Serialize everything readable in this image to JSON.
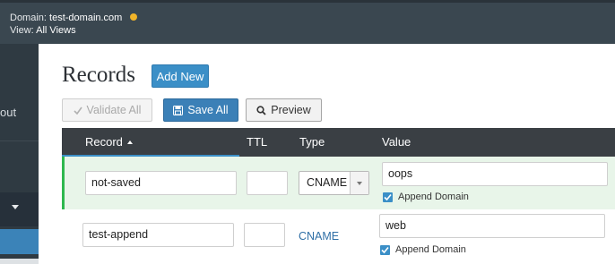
{
  "topbar": {
    "domain_key": "Domain:",
    "domain_value": "test-domain.com",
    "view_key": "View:",
    "view_value": "All Views"
  },
  "sidebar": {
    "logout_partial": "out"
  },
  "page": {
    "title": "Records",
    "add_new_label": "Add New"
  },
  "toolbar": {
    "validate_label": "Validate All",
    "save_label": "Save All",
    "preview_label": "Preview"
  },
  "table": {
    "headers": [
      "Record",
      "TTL",
      "Type",
      "Value"
    ],
    "rows": [
      {
        "record": "not-saved",
        "ttl": "",
        "type": "CNAME",
        "value": "oops",
        "append_label": "Append Domain",
        "append_checked": true
      },
      {
        "record": "test-append",
        "ttl": "",
        "type": "CNAME",
        "value": "web",
        "append_label": "Append Domain",
        "append_checked": true
      }
    ]
  },
  "colors": {
    "accent": "#3b8fc7",
    "unsaved_row": "#e8f5e9",
    "unsaved_marker": "#2fb84f",
    "status_dot": "#f0b429"
  }
}
